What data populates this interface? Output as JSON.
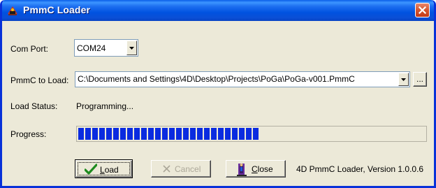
{
  "window": {
    "title": "PmmC Loader",
    "app_icon": "loader-app-icon",
    "close_icon": "close-icon"
  },
  "com_port": {
    "label": "Com Port:",
    "selected": "COM24"
  },
  "pmmc_to_load": {
    "label": "PmmC to Load:",
    "path": "C:\\Documents and Settings\\4D\\Desktop\\Projects\\PoGa\\PoGa-v001.PmmC",
    "browse_label": "..."
  },
  "load_status": {
    "label": "Load Status:",
    "value": "Programming..."
  },
  "progress": {
    "label": "Progress:",
    "fraction": 0.52
  },
  "buttons": {
    "load": {
      "mnemonic": "L",
      "rest": "oad",
      "icon": "checkmark-icon"
    },
    "cancel": {
      "text": "Cancel",
      "icon": "x-cancel-icon",
      "enabled": false
    },
    "close": {
      "mnemonic": "C",
      "rest": "lose",
      "icon": "door-exit-icon"
    }
  },
  "version_text": "4D PmmC Loader, Version 1.0.0.6",
  "colors": {
    "titlebar": "#0a4fd6",
    "progress_fill": "#0a2be0",
    "dialog_bg": "#ece9d8",
    "close_button": "#d4552e"
  }
}
